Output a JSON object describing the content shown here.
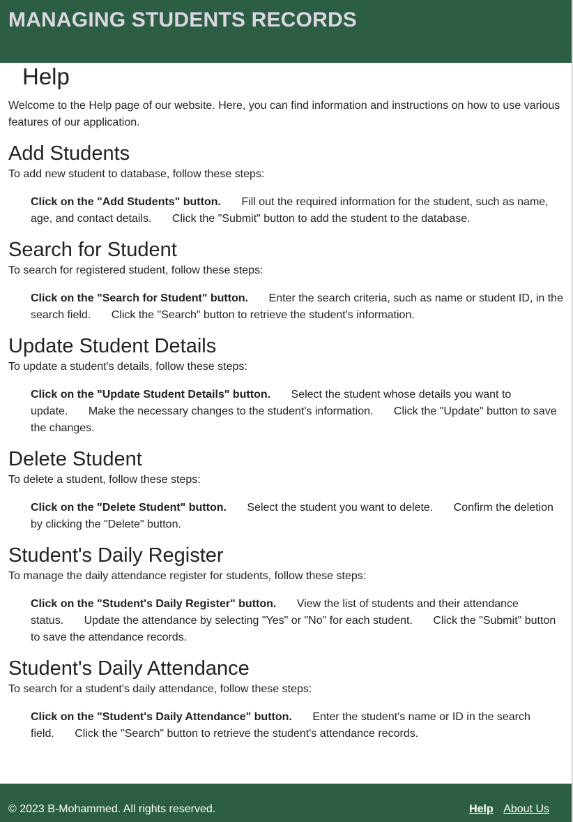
{
  "header": {
    "title": "MANAGING STUDENTS RECORDS"
  },
  "page": {
    "title": "Help",
    "intro": "Welcome to the Help page of our website. Here, you can find information and instructions on how to use various features of our application."
  },
  "sections": [
    {
      "title": "Add Students",
      "desc": "To add new student to database, follow these steps:",
      "steps": [
        "Click on the \"Add Students\" button.",
        "Fill out the required information for the student, such as name, age, and contact details.",
        "Click the \"Submit\" button to add the student to the database."
      ]
    },
    {
      "title": "Search for Student",
      "desc": "To search for registered student, follow these steps:",
      "steps": [
        "Click on the \"Search for Student\" button.",
        "Enter the search criteria, such as name or student ID, in the search field.",
        "Click the \"Search\" button to retrieve the student's information."
      ]
    },
    {
      "title": "Update Student Details",
      "desc": "To update a student's details, follow these steps:",
      "steps": [
        "Click on the \"Update Student Details\" button.",
        "Select the student whose details you want to update.",
        "Make the necessary changes to the student's information.",
        "Click the \"Update\" button to save the changes."
      ]
    },
    {
      "title": "Delete Student",
      "desc": "To delete a student, follow these steps:",
      "steps": [
        "Click on the \"Delete Student\" button.",
        "Select the student you want to delete.",
        "Confirm the deletion by clicking the \"Delete\" button."
      ]
    },
    {
      "title": "Student's Daily Register",
      "desc": "To manage the daily attendance register for students, follow these steps:",
      "steps": [
        "Click on the \"Student's Daily Register\" button.",
        "View the list of students and their attendance status.",
        "Update the attendance by selecting \"Yes\" or \"No\" for each student.",
        "Click the \"Submit\" button to save the attendance records."
      ]
    },
    {
      "title": "Student's Daily Attendance",
      "desc": "To search for a student's daily attendance, follow these steps:",
      "steps": [
        "Click on the \"Student's Daily Attendance\" button.",
        "Enter the student's name or ID in the search field.",
        "Click the \"Search\" button to retrieve the student's attendance records."
      ]
    }
  ],
  "footer": {
    "copyright": "© 2023 B-Mohammed. All rights reserved.",
    "links": [
      "Help",
      "About Us"
    ]
  },
  "colors": {
    "bar": "#2c5e43",
    "title_text": "#dcd7e2",
    "footer_text": "#ffffff"
  }
}
